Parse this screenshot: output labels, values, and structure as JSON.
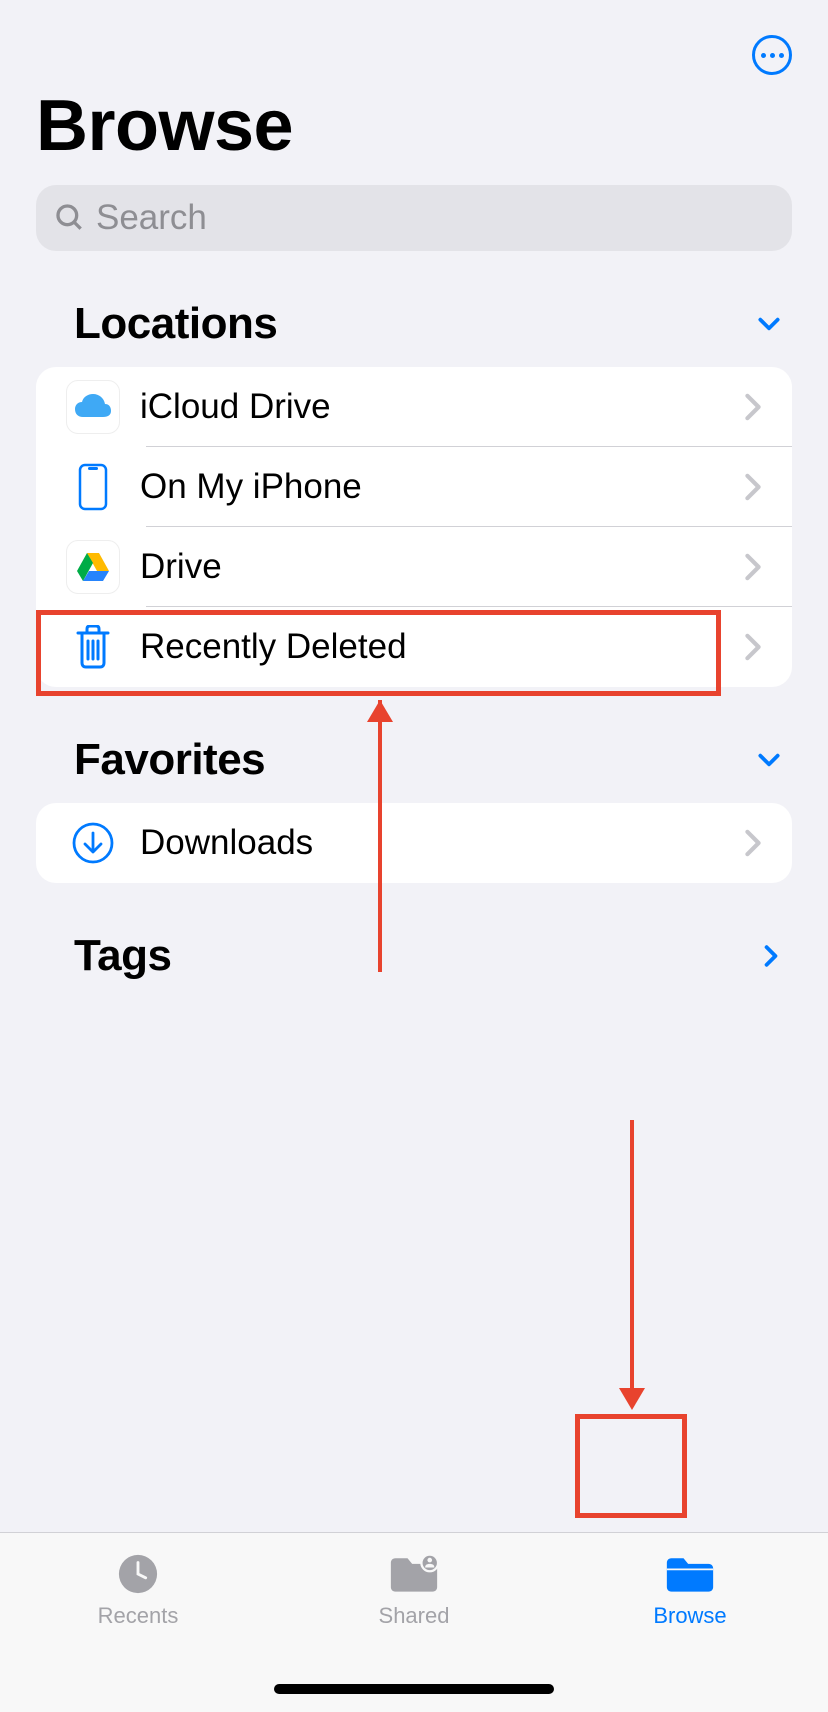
{
  "header": {
    "title": "Browse"
  },
  "search": {
    "placeholder": "Search"
  },
  "sections": {
    "locations": {
      "title": "Locations",
      "items": [
        {
          "label": "iCloud Drive",
          "icon": "icloud-icon"
        },
        {
          "label": "On My iPhone",
          "icon": "iphone-icon"
        },
        {
          "label": "Drive",
          "icon": "gdrive-icon"
        },
        {
          "label": "Recently Deleted",
          "icon": "trash-icon"
        }
      ]
    },
    "favorites": {
      "title": "Favorites",
      "items": [
        {
          "label": "Downloads",
          "icon": "download-icon"
        }
      ]
    },
    "tags": {
      "title": "Tags"
    }
  },
  "tabs": {
    "recents": "Recents",
    "shared": "Shared",
    "browse": "Browse"
  },
  "colors": {
    "accent": "#007aff",
    "highlight": "#e8432e",
    "background": "#f2f2f7"
  }
}
